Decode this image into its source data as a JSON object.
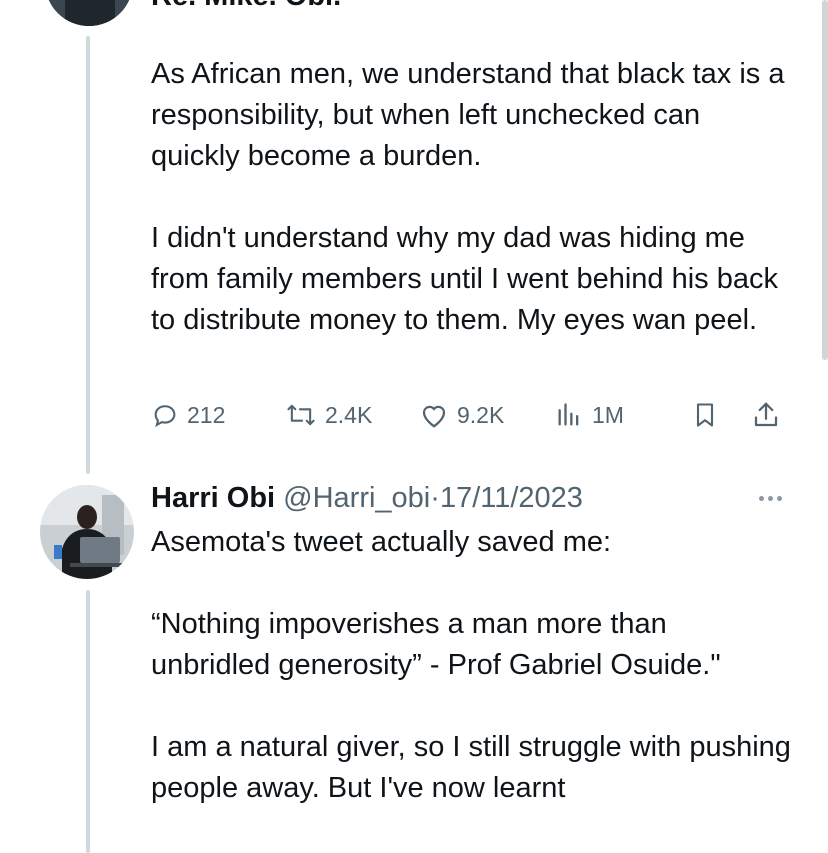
{
  "colors": {
    "text": "#0f1419",
    "secondary": "#536471",
    "thread_line": "#cfd9de"
  },
  "previous_tweet": {
    "header_fragment": "Re. Mike. Obi.",
    "text": "As African men, we understand that black tax is a responsibility, but when left unchecked can quickly become a burden.\n\nI didn't understand why my dad was hiding me from family members until I went behind his back to distribute money to them. My eyes wan peel.",
    "actions": {
      "reply_icon": "reply-icon",
      "reply_count": "212",
      "retweet_icon": "retweet-icon",
      "retweet_count": "2.4K",
      "like_icon": "heart-icon",
      "like_count": "9.2K",
      "views_icon": "views-chart-icon",
      "views_count": "1M",
      "bookmark_icon": "bookmark-icon",
      "share_icon": "share-icon"
    }
  },
  "tweet": {
    "name": "Harri Obi",
    "handle": "@Harri_obi",
    "separator": "·",
    "date": "17/11/2023",
    "more_icon": "more-dots-icon",
    "text": "Asemota's tweet actually saved me:\n\n“Nothing impoverishes a man more than unbridled generosity” - Prof Gabriel Osuide.\"\n\nI am a natural giver, so I still struggle with pushing people away. But I've now learnt"
  }
}
